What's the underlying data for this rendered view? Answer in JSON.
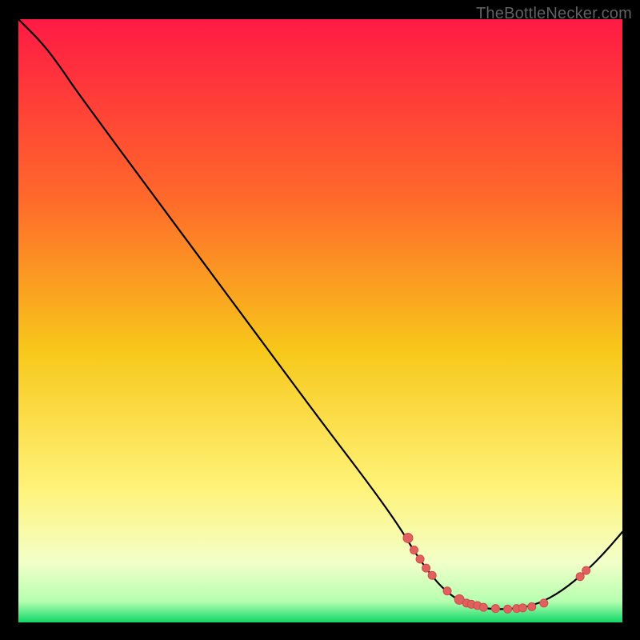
{
  "watermark": "TheBottleNecker.com",
  "colors": {
    "frame_black": "#000000",
    "grad_top": "#ff1a44",
    "grad_mid_up": "#ff7b20",
    "grad_mid": "#f7d21a",
    "grad_low": "#fff8a8",
    "grad_pale": "#f3ffd0",
    "grad_bottom": "#12e46a",
    "curve": "#000000",
    "marker_fill": "#e06060",
    "marker_stroke": "#d24a4a"
  },
  "chart_data": {
    "type": "line",
    "title": "",
    "xlabel": "",
    "ylabel": "",
    "xlim": [
      0,
      100
    ],
    "ylim": [
      0,
      100
    ],
    "gradient_stops": [
      {
        "pos": 0.0,
        "color": "#ff1a44"
      },
      {
        "pos": 0.3,
        "color": "#ff6a2a"
      },
      {
        "pos": 0.55,
        "color": "#f7c81a"
      },
      {
        "pos": 0.78,
        "color": "#fff37a"
      },
      {
        "pos": 0.9,
        "color": "#f2ffc8"
      },
      {
        "pos": 0.965,
        "color": "#b6ffb0"
      },
      {
        "pos": 1.0,
        "color": "#10d868"
      }
    ],
    "curve_points": [
      {
        "x": 0.0,
        "y": 100.0
      },
      {
        "x": 4.0,
        "y": 96.0
      },
      {
        "x": 7.0,
        "y": 92.0
      },
      {
        "x": 9.0,
        "y": 89.0
      },
      {
        "x": 13.0,
        "y": 83.5
      },
      {
        "x": 20.0,
        "y": 74.0
      },
      {
        "x": 30.0,
        "y": 60.5
      },
      {
        "x": 40.0,
        "y": 47.0
      },
      {
        "x": 50.0,
        "y": 33.5
      },
      {
        "x": 58.0,
        "y": 23.0
      },
      {
        "x": 63.0,
        "y": 16.0
      },
      {
        "x": 66.0,
        "y": 11.0
      },
      {
        "x": 69.0,
        "y": 7.0
      },
      {
        "x": 71.0,
        "y": 5.0
      },
      {
        "x": 73.0,
        "y": 3.6
      },
      {
        "x": 75.0,
        "y": 2.8
      },
      {
        "x": 78.0,
        "y": 2.2
      },
      {
        "x": 82.0,
        "y": 2.2
      },
      {
        "x": 86.0,
        "y": 3.0
      },
      {
        "x": 90.0,
        "y": 5.2
      },
      {
        "x": 94.0,
        "y": 8.5
      },
      {
        "x": 97.0,
        "y": 11.5
      },
      {
        "x": 100.0,
        "y": 15.0
      }
    ],
    "markers": [
      {
        "x": 64.5,
        "y": 14.0,
        "r": 6
      },
      {
        "x": 65.5,
        "y": 12.0,
        "r": 5
      },
      {
        "x": 66.5,
        "y": 10.5,
        "r": 5
      },
      {
        "x": 67.5,
        "y": 9.0,
        "r": 5
      },
      {
        "x": 68.5,
        "y": 7.8,
        "r": 5
      },
      {
        "x": 71.0,
        "y": 5.2,
        "r": 5
      },
      {
        "x": 73.0,
        "y": 3.8,
        "r": 6
      },
      {
        "x": 74.2,
        "y": 3.2,
        "r": 5
      },
      {
        "x": 75.0,
        "y": 3.0,
        "r": 5
      },
      {
        "x": 76.0,
        "y": 2.8,
        "r": 5
      },
      {
        "x": 77.0,
        "y": 2.5,
        "r": 5
      },
      {
        "x": 79.0,
        "y": 2.3,
        "r": 5
      },
      {
        "x": 81.0,
        "y": 2.2,
        "r": 5
      },
      {
        "x": 82.5,
        "y": 2.3,
        "r": 5
      },
      {
        "x": 83.5,
        "y": 2.4,
        "r": 5
      },
      {
        "x": 85.0,
        "y": 2.6,
        "r": 5
      },
      {
        "x": 87.0,
        "y": 3.2,
        "r": 5
      },
      {
        "x": 93.0,
        "y": 7.6,
        "r": 5
      },
      {
        "x": 94.0,
        "y": 8.6,
        "r": 5
      }
    ]
  }
}
